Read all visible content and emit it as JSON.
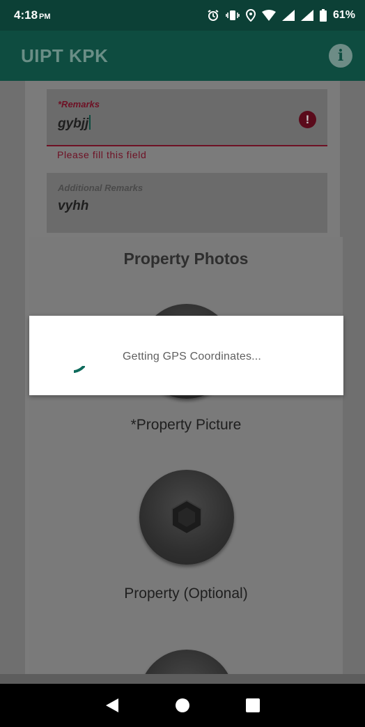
{
  "status_bar": {
    "time": "4:18",
    "ampm": "PM",
    "battery": "61%",
    "icons": [
      "alarm-icon",
      "vibrate-icon",
      "location-icon",
      "wifi-icon",
      "signal-icon",
      "signal-icon",
      "battery-icon"
    ]
  },
  "app_bar": {
    "title": "UIPT KPK",
    "info_icon": "info-icon",
    "info_glyph": "i"
  },
  "form": {
    "remarks": {
      "label": "*Remarks",
      "value": "gybjj",
      "error": "Please fill this field",
      "error_glyph": "!"
    },
    "additional_remarks": {
      "label": "Additional Remarks",
      "value": "vyhh"
    }
  },
  "photos": {
    "title": "Property Photos",
    "items": [
      {
        "label": "*Property Picture"
      },
      {
        "label": "Property (Optional)"
      }
    ]
  },
  "dialog": {
    "message": "Getting GPS Coordinates..."
  },
  "colors": {
    "app_bar": "#0e4c40",
    "error": "#6e1024",
    "accent": "#0e6b5c"
  }
}
